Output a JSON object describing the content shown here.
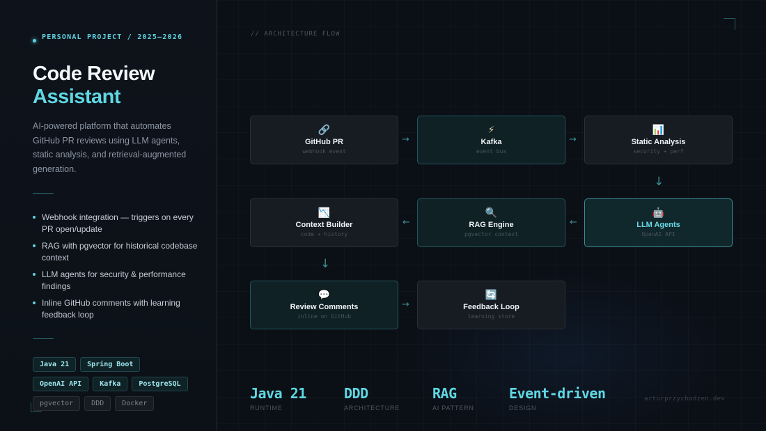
{
  "left": {
    "eyebrow": "PERSONAL PROJECT  /  2025–2026",
    "title_line1": "Code Review",
    "title_line2": "Assistant",
    "description": "AI-powered platform that automates GitHub PR reviews using LLM agents, static analysis, and retrieval-augmented generation.",
    "bullets": [
      "Webhook integration — triggers on every PR open/update",
      "RAG with pgvector for historical codebase context",
      "LLM agents for security & performance findings",
      "Inline GitHub comments with learning feedback loop"
    ],
    "tags_primary": [
      "Java 21",
      "Spring Boot",
      "OpenAI API",
      "Kafka",
      "PostgreSQL"
    ],
    "tags_muted": [
      "pgvector",
      "DDD",
      "Docker"
    ]
  },
  "flow": {
    "label": "// ARCHITECTURE FLOW",
    "nodes": [
      {
        "icon": "🔗",
        "icon_name": "link-icon",
        "name": "GitHub PR",
        "sub": "webhook event"
      },
      {
        "icon": "⚡",
        "icon_name": "lightning-icon",
        "name": "Kafka",
        "sub": "event bus"
      },
      {
        "icon": "📊",
        "icon_name": "bar-chart-icon",
        "name": "Static Analysis",
        "sub": "security + perf"
      },
      {
        "icon": "🤖",
        "icon_name": "robot-icon",
        "name": "LLM Agents",
        "sub": "OpenAI API"
      },
      {
        "icon": "🔍",
        "icon_name": "magnifier-icon",
        "name": "RAG Engine",
        "sub": "pgvector context"
      },
      {
        "icon": "📉",
        "icon_name": "chart-down-icon",
        "name": "Context Builder",
        "sub": "code + history"
      },
      {
        "icon": "💬",
        "icon_name": "speech-bubble-icon",
        "name": "Review Comments",
        "sub": "inline on GitHub"
      },
      {
        "icon": "🔄",
        "icon_name": "refresh-icon",
        "name": "Feedback Loop",
        "sub": "learning store"
      }
    ]
  },
  "stats": [
    {
      "value": "Java 21",
      "label": "RUNTIME"
    },
    {
      "value": "DDD",
      "label": "ARCHITECTURE"
    },
    {
      "value": "RAG",
      "label": "AI PATTERN"
    },
    {
      "value": "Event-driven",
      "label": "DESIGN"
    }
  ],
  "credit": "arturprzychodzen.dev",
  "colors": {
    "accent": "#5fd8e3",
    "background": "#0b0f16"
  }
}
